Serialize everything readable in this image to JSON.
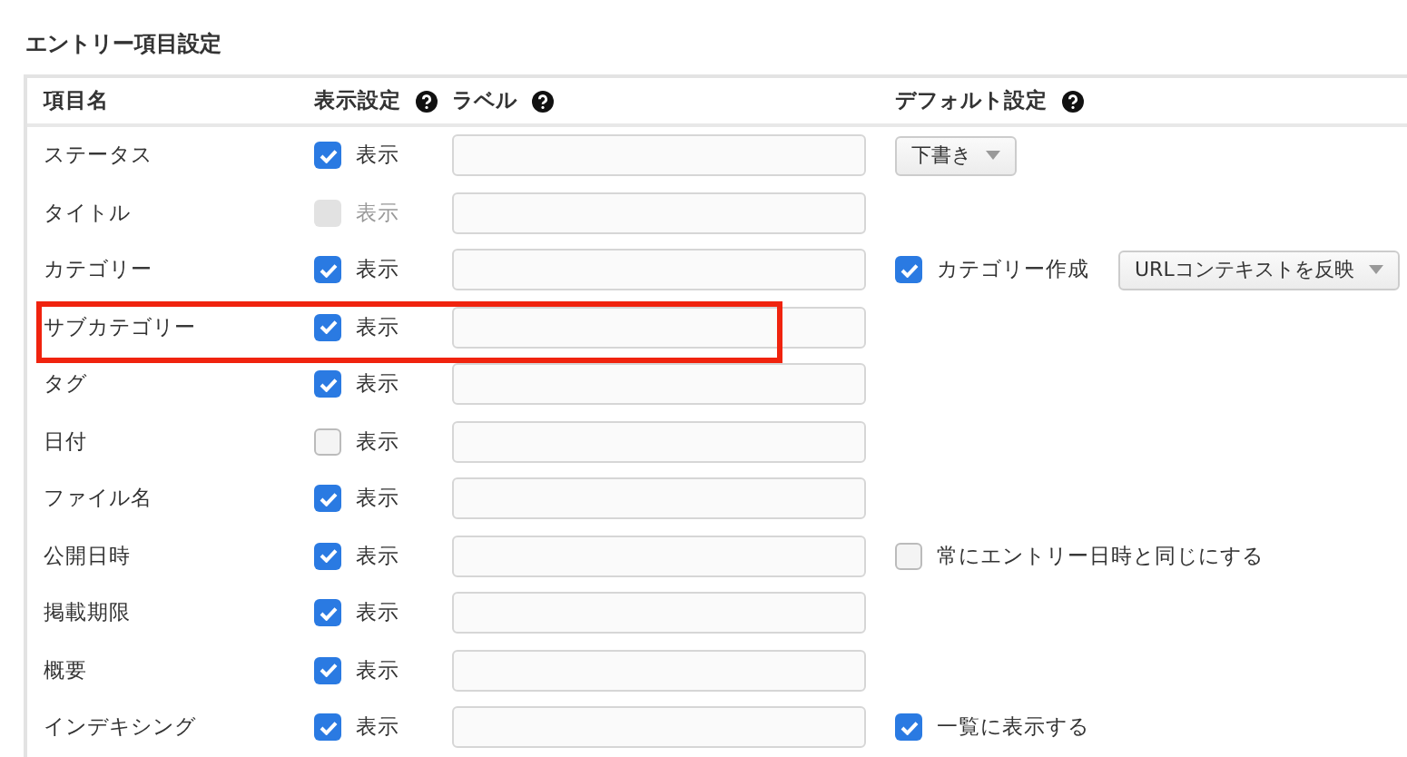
{
  "section_title": "エントリー項目設定",
  "columns": [
    {
      "label": "項目名",
      "help": false
    },
    {
      "label": "表示設定",
      "help": true
    },
    {
      "label": "ラベル",
      "help": true
    },
    {
      "label": "デフォルト設定",
      "help": true
    }
  ],
  "rows": [
    {
      "name": "ステータス",
      "show": {
        "label": "表示",
        "checked": true,
        "disabled": false
      },
      "highlighted": false,
      "defaults": [
        {
          "kind": "select",
          "value": "下書き"
        }
      ]
    },
    {
      "name": "タイトル",
      "show": {
        "label": "表示",
        "checked": false,
        "disabled": true
      },
      "highlighted": false,
      "defaults": []
    },
    {
      "name": "カテゴリー",
      "show": {
        "label": "表示",
        "checked": true,
        "disabled": false
      },
      "highlighted": false,
      "defaults": [
        {
          "kind": "checkbox",
          "label": "カテゴリー作成",
          "checked": true
        },
        {
          "kind": "select",
          "value": "URLコンテキストを反映"
        }
      ]
    },
    {
      "name": "サブカテゴリー",
      "show": {
        "label": "表示",
        "checked": true,
        "disabled": false
      },
      "highlighted": true,
      "defaults": []
    },
    {
      "name": "タグ",
      "show": {
        "label": "表示",
        "checked": true,
        "disabled": false
      },
      "highlighted": false,
      "defaults": []
    },
    {
      "name": "日付",
      "show": {
        "label": "表示",
        "checked": false,
        "disabled": false
      },
      "highlighted": false,
      "defaults": []
    },
    {
      "name": "ファイル名",
      "show": {
        "label": "表示",
        "checked": true,
        "disabled": false
      },
      "highlighted": false,
      "defaults": []
    },
    {
      "name": "公開日時",
      "show": {
        "label": "表示",
        "checked": true,
        "disabled": false
      },
      "highlighted": false,
      "defaults": [
        {
          "kind": "checkbox",
          "label": "常にエントリー日時と同じにする",
          "checked": false
        }
      ]
    },
    {
      "name": "掲載期限",
      "show": {
        "label": "表示",
        "checked": true,
        "disabled": false
      },
      "highlighted": false,
      "defaults": []
    },
    {
      "name": "概要",
      "show": {
        "label": "表示",
        "checked": true,
        "disabled": false
      },
      "highlighted": false,
      "defaults": []
    },
    {
      "name": "インデキシング",
      "show": {
        "label": "表示",
        "checked": true,
        "disabled": false
      },
      "highlighted": false,
      "defaults": [
        {
          "kind": "checkbox",
          "label": "一覧に表示する",
          "checked": true
        }
      ]
    }
  ]
}
